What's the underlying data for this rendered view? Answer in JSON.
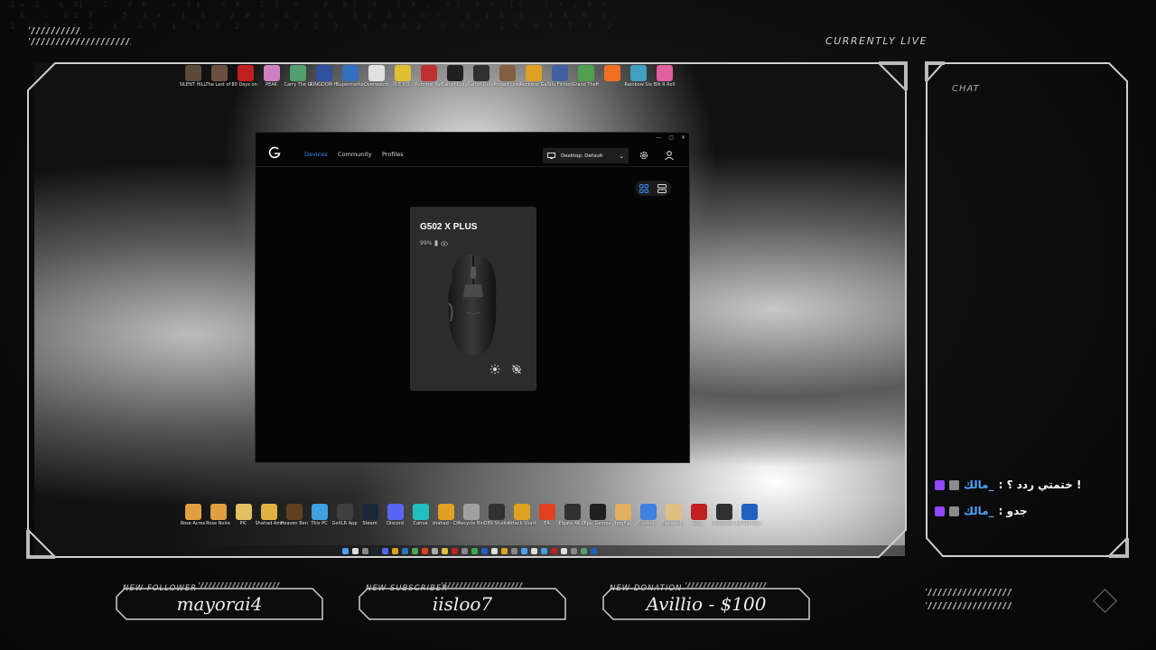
{
  "overlay": {
    "live_label": "CURRENTLY LIVE",
    "chat_title": "CHAT",
    "chat_messages": [
      {
        "user": "مالك_",
        "text": ": ختمتي ردد ؟ !"
      },
      {
        "user": "مالك_",
        "text": ": جدو"
      }
    ],
    "alerts": [
      {
        "label": "NEW FOLLOWER",
        "value": "mayorai4"
      },
      {
        "label": "NEW SUBSCRIBER",
        "value": "iisloo7"
      },
      {
        "label": "NEW DONATION",
        "value": "Avillio - $100"
      }
    ]
  },
  "desktop": {
    "top_icons": [
      {
        "label": "SILENT HILL f",
        "color": "#5a4a3a"
      },
      {
        "label": "The Last of Us Part I",
        "color": "#6a5040"
      },
      {
        "label": "30 Days on Ship Demo",
        "color": "#c02020"
      },
      {
        "label": "PEAK",
        "color": "#d080c0"
      },
      {
        "label": "Carry The Glass",
        "color": "#50a070"
      },
      {
        "label": "KINGDOM HEARTS I...",
        "color": "#3050a0"
      },
      {
        "label": "Supermarket Simulator",
        "color": "#3070c0"
      },
      {
        "label": "Overwatch",
        "color": "#e0e0e0"
      },
      {
        "label": "R.E.P.O.",
        "color": "#e0c030"
      },
      {
        "label": "Pummel Party",
        "color": "#c03030"
      },
      {
        "label": "Call of Duty®",
        "color": "#202020"
      },
      {
        "label": "Call of Duty®",
        "color": "#303030"
      },
      {
        "label": "Project Unknown",
        "color": "#806040"
      },
      {
        "label": "Rockstar Games...",
        "color": "#e0a020"
      },
      {
        "label": "Sifu Fiction",
        "color": "#4060a0"
      },
      {
        "label": "Grand Theft Au...",
        "color": "#50a050"
      },
      {
        "label": "",
        "color": "#f07020"
      },
      {
        "label": "Rainbow Six Intel...",
        "color": "#40a0c0"
      },
      {
        "label": "Blk R Roll",
        "color": "#e060a0"
      }
    ],
    "bottom_icons": [
      {
        "label": "Rose Acres",
        "color": "#e0a040"
      },
      {
        "label": "Rose Noire",
        "color": "#e0a040"
      },
      {
        "label": "PIC",
        "color": "#e0c060"
      },
      {
        "label": "Shahad Ammar",
        "color": "#e0b040"
      },
      {
        "label": "Heaven Benchma...",
        "color": "#604020"
      },
      {
        "label": "This PC",
        "color": "#40a0e0"
      },
      {
        "label": "GeXLR App",
        "color": "#404040"
      },
      {
        "label": "Steam",
        "color": "#1b2838"
      },
      {
        "label": "Discord",
        "color": "#5865f2"
      },
      {
        "label": "Canva",
        "color": "#20c0c0"
      },
      {
        "label": "shahad - Chrome (1)",
        "color": "#e0a020"
      },
      {
        "label": "Recycle Bin",
        "color": "#a0a0a0"
      },
      {
        "label": "OBS Studio",
        "color": "#303030"
      },
      {
        "label": "Attack Shark X6...",
        "color": "#e0a020"
      },
      {
        "label": "EA",
        "color": "#e04020"
      },
      {
        "label": "Elgato 4K Capture...",
        "color": "#303030"
      },
      {
        "label": "Epic Games Launcher",
        "color": "#202020"
      },
      {
        "label": "Imgflip",
        "color": "#e0b060"
      },
      {
        "label": "Control...",
        "color": "#4080e0"
      },
      {
        "label": "Elevated...",
        "color": "#e0c080"
      },
      {
        "label": "Rog...",
        "color": "#c02020"
      },
      {
        "label": "L-Connect 3",
        "color": "#303030"
      },
      {
        "label": "PS Remote...",
        "color": "#2060c0"
      }
    ]
  },
  "ghub": {
    "nav": {
      "devices": "Devices",
      "community": "Community",
      "profiles": "Profiles"
    },
    "window_buttons": {
      "minimize": "—",
      "maximize": "▢",
      "close": "✕"
    },
    "profile_selector": "Desktop: Default",
    "device": {
      "name": "G502 X PLUS",
      "battery": "99%"
    }
  }
}
